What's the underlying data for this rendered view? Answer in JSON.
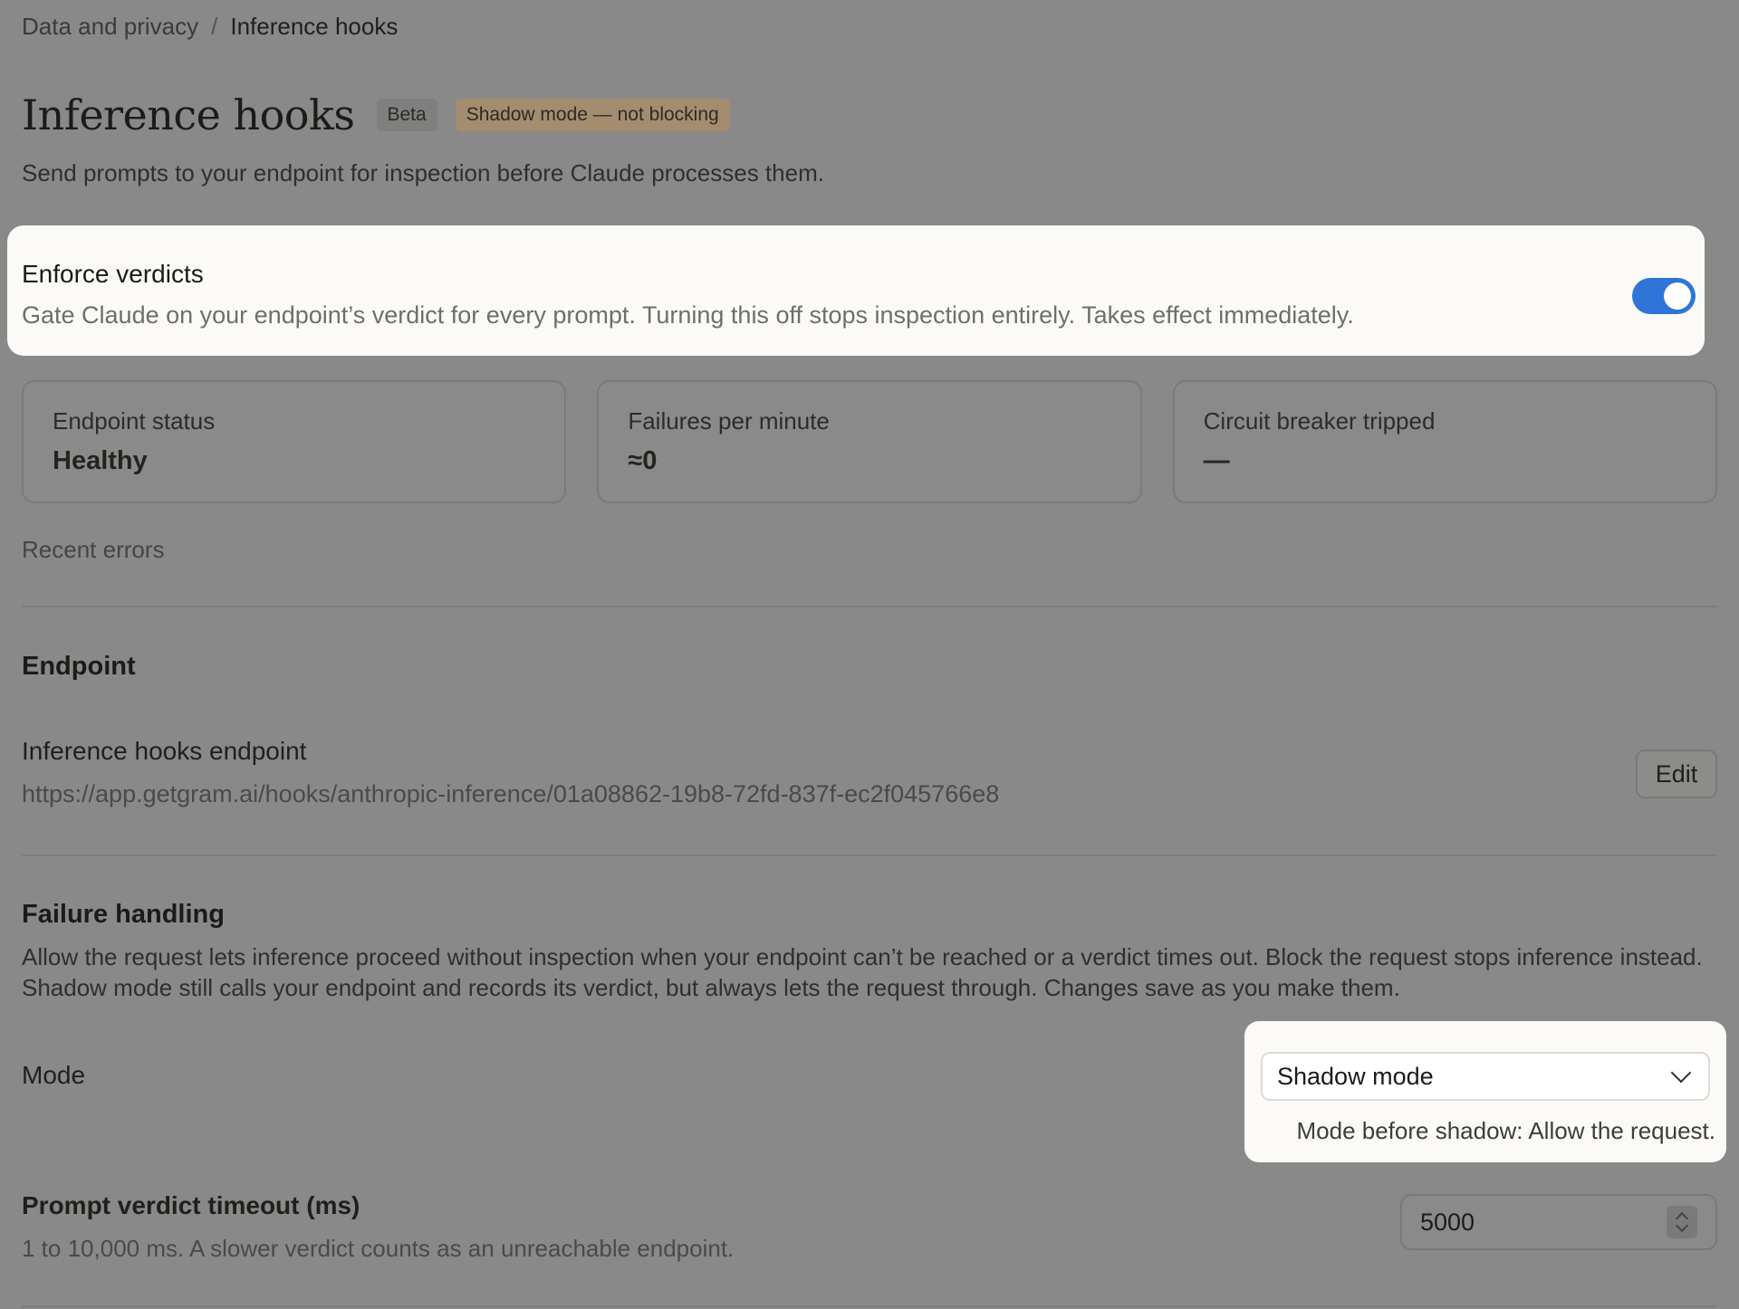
{
  "breadcrumb": {
    "parent": "Data and privacy",
    "separator": "/",
    "current": "Inference hooks"
  },
  "header": {
    "title": "Inference hooks",
    "beta_badge": "Beta",
    "shadow_badge": "Shadow mode — not blocking",
    "subtitle": "Send prompts to your endpoint for inspection before Claude processes them."
  },
  "enforce": {
    "title": "Enforce verdicts",
    "description": "Gate Claude on your endpoint’s verdict for every prompt. Turning this off stops inspection entirely. Takes effect immediately.",
    "enabled": true
  },
  "stats": [
    {
      "label": "Endpoint status",
      "value": "Healthy"
    },
    {
      "label": "Failures per minute",
      "value": "≈0"
    },
    {
      "label": "Circuit breaker tripped",
      "value": "—"
    }
  ],
  "recent_errors_label": "Recent errors",
  "endpoint_section": {
    "heading": "Endpoint",
    "field_label": "Inference hooks endpoint",
    "url": "https://app.getgram.ai/hooks/anthropic-inference/01a08862-19b8-72fd-837f-ec2f045766e8",
    "edit_label": "Edit"
  },
  "failure_section": {
    "heading": "Failure handling",
    "description": "Allow the request lets inference proceed without inspection when your endpoint can’t be reached or a verdict times out. Block the request stops inference instead. Shadow mode still calls your endpoint and records its verdict, but always lets the request through. Changes save as you make them.",
    "mode_label": "Mode",
    "mode_value": "Shadow mode",
    "mode_hint": "Mode before shadow: Allow the request."
  },
  "timeout": {
    "label": "Prompt verdict timeout (ms)",
    "help": "1 to 10,000 ms. A slower verdict counts as an unreachable endpoint.",
    "value": "5000"
  },
  "colors": {
    "background": "#898989",
    "toggle_on": "#2f74d8",
    "shadow_badge": "#a38d6e",
    "card": "#fbfaf7"
  }
}
